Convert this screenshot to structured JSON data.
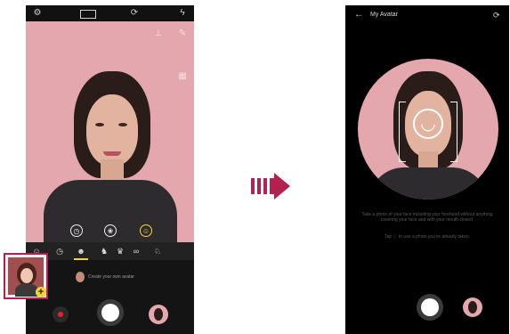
{
  "left_screen": {
    "status_icons": [
      "settings-icon",
      "ratio-icon",
      "switch-camera-icon",
      "flash-off-icon"
    ],
    "top_overlay_icons": [
      "level-icon",
      "edit-icon",
      "grid-icon"
    ],
    "mode_icons": [
      "timer-icon",
      "effects-icon",
      "smiley-icon"
    ],
    "sticker_icons": [
      "sticker-face-icon",
      "timer-icon",
      "avatar-icon",
      "cat-icon",
      "crown-icon",
      "glasses-icon",
      "dog-icon"
    ],
    "create_avatar_text": "Create your own avatar",
    "accent_color": "#f2d23a",
    "highlight_color": "#b2214f"
  },
  "right_screen": {
    "title": "My Avatar",
    "instruction_line1": "Take a photo of your face including your forehead without anything covering your face and with your mouth closed.",
    "instruction_line2": "Tap ⓘ to use a photo you've already taken."
  }
}
